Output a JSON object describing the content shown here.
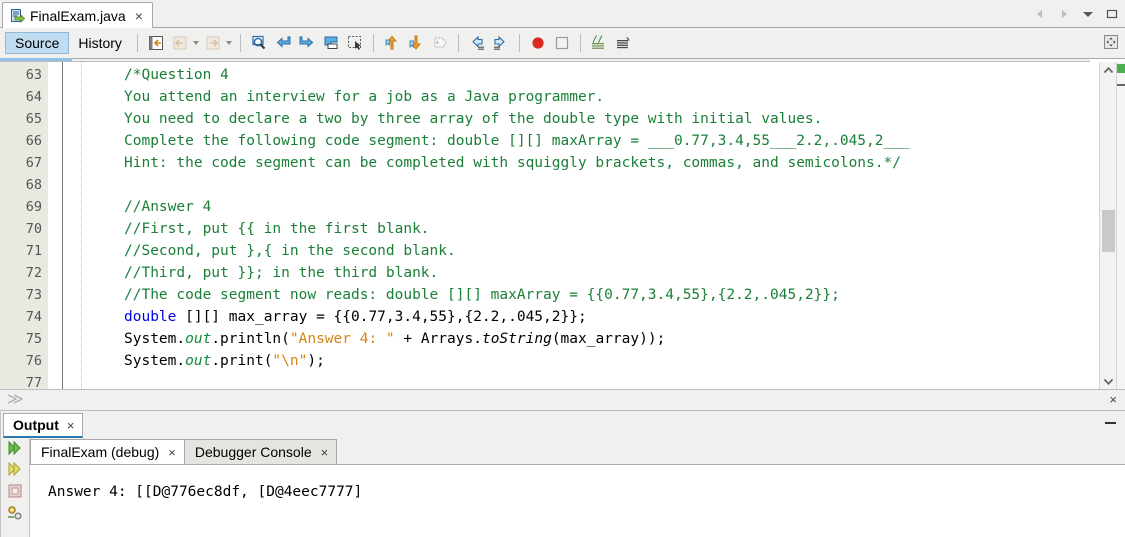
{
  "window": {
    "controls": [
      {
        "name": "prev-tab-button",
        "glyph": "◀"
      },
      {
        "name": "next-tab-button",
        "glyph": "▶"
      },
      {
        "name": "tab-list-dropdown",
        "glyph": "▼"
      },
      {
        "name": "maximize-button",
        "glyph": "□"
      }
    ]
  },
  "editor_tab": {
    "title": "FinalExam.java",
    "close_label": "×",
    "icon": "java-file-icon"
  },
  "toolbar": {
    "view_tabs": [
      {
        "label": "Source",
        "selected": true
      },
      {
        "label": "History",
        "selected": false
      }
    ],
    "buttons": [
      {
        "name": "last-edit-button",
        "icon": "last-edit-icon"
      },
      {
        "name": "back-button",
        "icon": "back-arrow-icon"
      },
      {
        "name": "forward-button",
        "icon": "forward-arrow-icon"
      },
      {
        "name": "find-selection-button",
        "icon": "magnifier-icon"
      },
      {
        "name": "find-previous-button",
        "icon": "find-previous-icon"
      },
      {
        "name": "find-next-button",
        "icon": "find-next-icon"
      },
      {
        "name": "toggle-highlight-button",
        "icon": "toggle-highlight-icon"
      },
      {
        "name": "toggle-rectangular-selection-button",
        "icon": "rectangular-selection-icon"
      },
      {
        "name": "previous-bookmark-button",
        "icon": "up-arrow-bookmark-icon"
      },
      {
        "name": "next-bookmark-button",
        "icon": "down-arrow-bookmark-icon"
      },
      {
        "name": "toggle-bookmark-button",
        "icon": "bookmark-icon"
      },
      {
        "name": "shift-left-button",
        "icon": "shift-left-icon"
      },
      {
        "name": "shift-right-button",
        "icon": "shift-right-icon"
      },
      {
        "name": "toggle-breakpoint-button",
        "icon": "breakpoint-circle-icon"
      },
      {
        "name": "stop-button",
        "icon": "stop-square-icon"
      },
      {
        "name": "comment-button",
        "icon": "comment-lines-icon"
      },
      {
        "name": "uncomment-button",
        "icon": "uncomment-lines-icon"
      }
    ],
    "expand_button": "expand-editor-icon"
  },
  "editor": {
    "first_line": 63,
    "lines": [
      {
        "n": 63,
        "tokens": [
          {
            "t": "/*Question 4",
            "c": "cmt"
          }
        ]
      },
      {
        "n": 64,
        "tokens": [
          {
            "t": "You attend an interview for a job as a Java programmer.",
            "c": "cmt"
          }
        ]
      },
      {
        "n": 65,
        "tokens": [
          {
            "t": "You need to declare a two by three array of the double type with initial values.",
            "c": "cmt"
          }
        ]
      },
      {
        "n": 66,
        "tokens": [
          {
            "t": "Complete the following code segment: double [][] maxArray = ___0.77,3.4,55___2.2,.045,2___",
            "c": "cmt"
          }
        ]
      },
      {
        "n": 67,
        "tokens": [
          {
            "t": "Hint: the code segment can be completed with squiggly brackets, commas, and semicolons.*/",
            "c": "cmt"
          }
        ]
      },
      {
        "n": 68,
        "tokens": []
      },
      {
        "n": 69,
        "tokens": [
          {
            "t": "//Answer 4",
            "c": "cmt"
          }
        ]
      },
      {
        "n": 70,
        "tokens": [
          {
            "t": "//First, put {{ in the first blank.",
            "c": "cmt"
          }
        ]
      },
      {
        "n": 71,
        "tokens": [
          {
            "t": "//Second, put },{ in the second blank.",
            "c": "cmt"
          }
        ]
      },
      {
        "n": 72,
        "tokens": [
          {
            "t": "//Third, put }}; in the third blank.",
            "c": "cmt"
          }
        ]
      },
      {
        "n": 73,
        "tokens": [
          {
            "t": "//The code segment now reads: double [][] maxArray = {{0.77,3.4,55},{2.2,.045,2}};",
            "c": "cmt"
          }
        ]
      },
      {
        "n": 74,
        "tokens": [
          {
            "t": "double",
            "c": "kw"
          },
          {
            "t": " [][] max_array = {{0.77,3.4,55},{2.2,.045,2}};",
            "c": ""
          }
        ]
      },
      {
        "n": 75,
        "tokens": [
          {
            "t": "System.",
            "c": ""
          },
          {
            "t": "out",
            "c": "fld"
          },
          {
            "t": ".println(",
            "c": ""
          },
          {
            "t": "\"Answer 4: \"",
            "c": "str"
          },
          {
            "t": " + Arrays.",
            "c": ""
          },
          {
            "t": "toString",
            "c": "mth"
          },
          {
            "t": "(max_array));",
            "c": ""
          }
        ]
      },
      {
        "n": 76,
        "tokens": [
          {
            "t": "System.",
            "c": ""
          },
          {
            "t": "out",
            "c": "fld"
          },
          {
            "t": ".print(",
            "c": ""
          },
          {
            "t": "\"\\n\"",
            "c": "str"
          },
          {
            "t": ");",
            "c": ""
          }
        ]
      },
      {
        "n": 77,
        "tokens": []
      }
    ],
    "scrollbar": {
      "up_arrow": "⌃",
      "down_arrow": "⌄"
    },
    "status": {
      "expand_glyph": "≫",
      "close_label": "×"
    }
  },
  "output": {
    "tab_label": "Output",
    "tab_close": "×",
    "minimize_label": "–",
    "sidebar_buttons": [
      {
        "name": "rerun-button",
        "icon": "run-green-icon"
      },
      {
        "name": "rerun-debug-button",
        "icon": "run-yellow-icon"
      },
      {
        "name": "stop-process-button",
        "icon": "stop-square-icon"
      },
      {
        "name": "output-settings-button",
        "icon": "gear-wrench-icon"
      }
    ],
    "subtabs": [
      {
        "label": "FinalExam (debug)",
        "close": "×",
        "active": true
      },
      {
        "label": "Debugger Console",
        "close": "×",
        "active": false
      }
    ],
    "console_text": "Answer 4: [[D@776ec8df, [D@4eec7777]"
  },
  "colors": {
    "comment": "#1a7f37",
    "keyword": "#0000e6",
    "string": "#d68413",
    "field": "#0f8a3a",
    "tab_selected": "#bfdcf0",
    "chrome": "#f0f0ef",
    "output_underline": "#2a7ab0",
    "status_ok": "#4caf50"
  }
}
